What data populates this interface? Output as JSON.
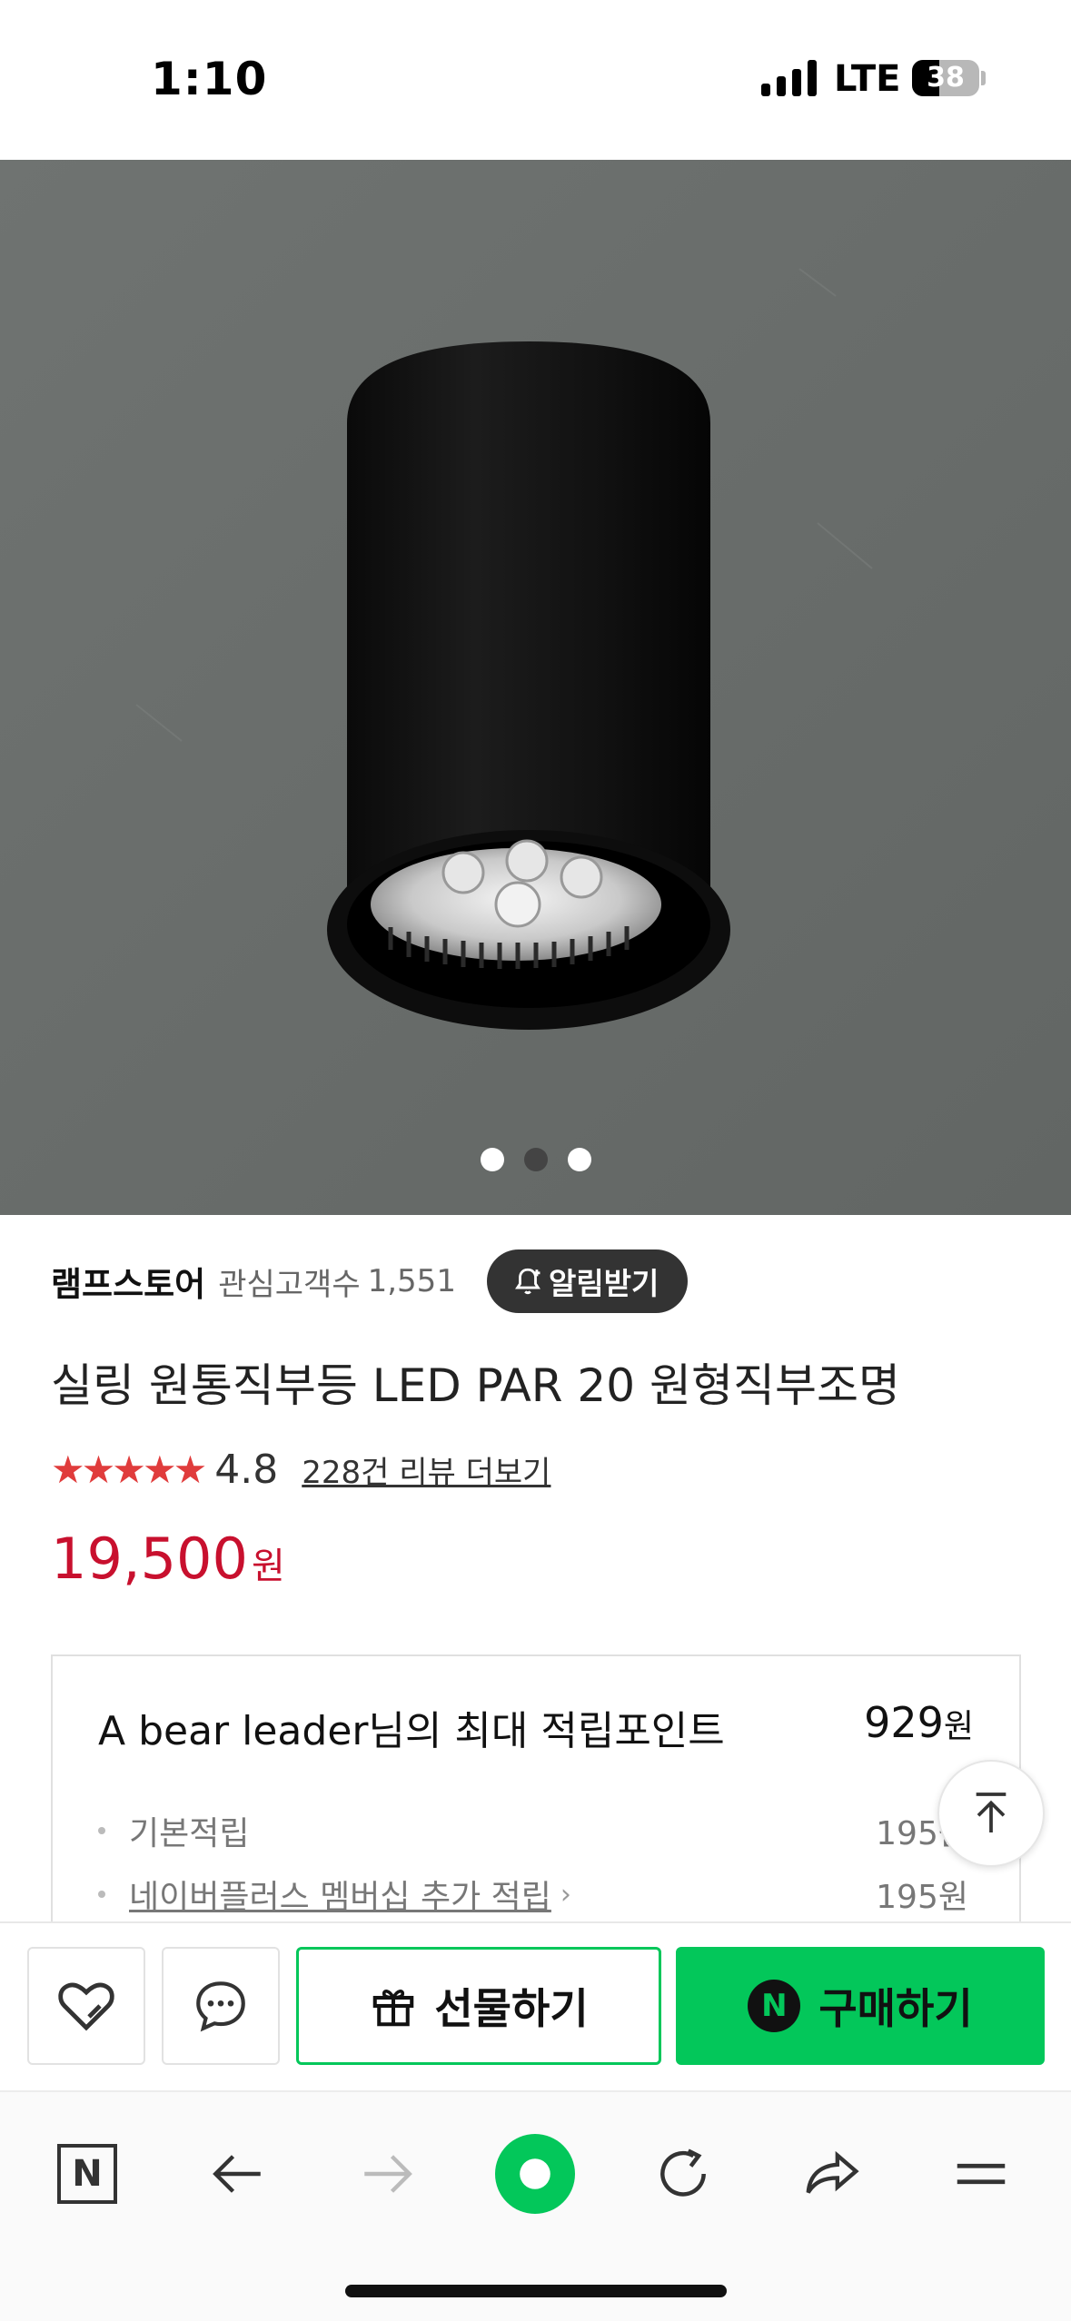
{
  "status_bar": {
    "time": "1:10",
    "network": "LTE",
    "battery": "38"
  },
  "gallery": {
    "slide_count": 3,
    "active_index": 1
  },
  "seller": {
    "name": "램프스토어",
    "followers_label": "관심고객수",
    "followers_count": "1,551",
    "alarm_label": "알림받기"
  },
  "product": {
    "title": "실링 원통직부등 LED PAR 20 원형직부조명",
    "stars": "★★★★★",
    "rating": "4.8",
    "review_link": "228건 리뷰 더보기",
    "price": "19,500",
    "price_unit": "원"
  },
  "points": {
    "title": "A bear leader님의 최대 적립포인트",
    "total": "929",
    "total_unit": "원",
    "items": [
      {
        "label": "기본적립",
        "value": "195원"
      },
      {
        "label": "네이버플러스 멤버십 추가 적립",
        "value": "195원"
      }
    ]
  },
  "actions": {
    "gift_label": "선물하기",
    "buy_label": "구매하기",
    "naver_badge": "N"
  },
  "browser": {
    "n_label": "N"
  },
  "colors": {
    "price_red": "#c8102e",
    "naver_green": "#03c75a",
    "star_red": "#e03c3c"
  }
}
